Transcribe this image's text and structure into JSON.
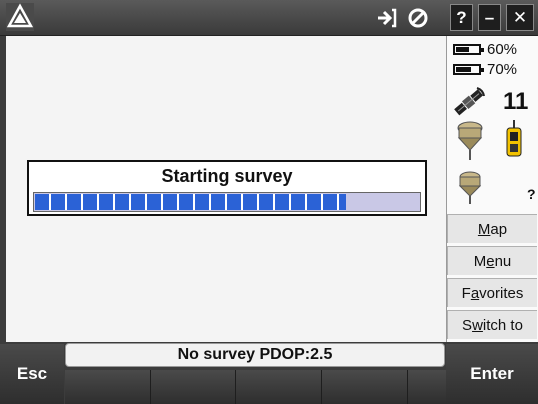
{
  "topbar": {
    "logo_icon": "trimble-triangle-logo-icon",
    "help_label": "?",
    "minimize_label": "–",
    "close_label": "✕"
  },
  "dialog": {
    "title": "Starting survey",
    "progress_fraction": 0.81
  },
  "status_panel": {
    "battery_1": "60%",
    "battery_1_level": 0.6,
    "battery_2": "70%",
    "battery_2_level": 0.7,
    "satellite_count": "11",
    "unknown_indicator": "?"
  },
  "side_buttons": {
    "map": {
      "pre": "",
      "u": "M",
      "post": "ap"
    },
    "menu": {
      "pre": "M",
      "u": "e",
      "post": "nu"
    },
    "favorites": {
      "pre": "F",
      "u": "a",
      "post": "vorites"
    },
    "switch_to": {
      "pre": "S",
      "u": "w",
      "post": "itch to"
    }
  },
  "status_line": "No survey  PDOP:2.5",
  "softkeys": {
    "esc": "Esc",
    "enter": "Enter"
  },
  "colors": {
    "progress": "#2b62d6",
    "track": "#c9c8e6"
  }
}
